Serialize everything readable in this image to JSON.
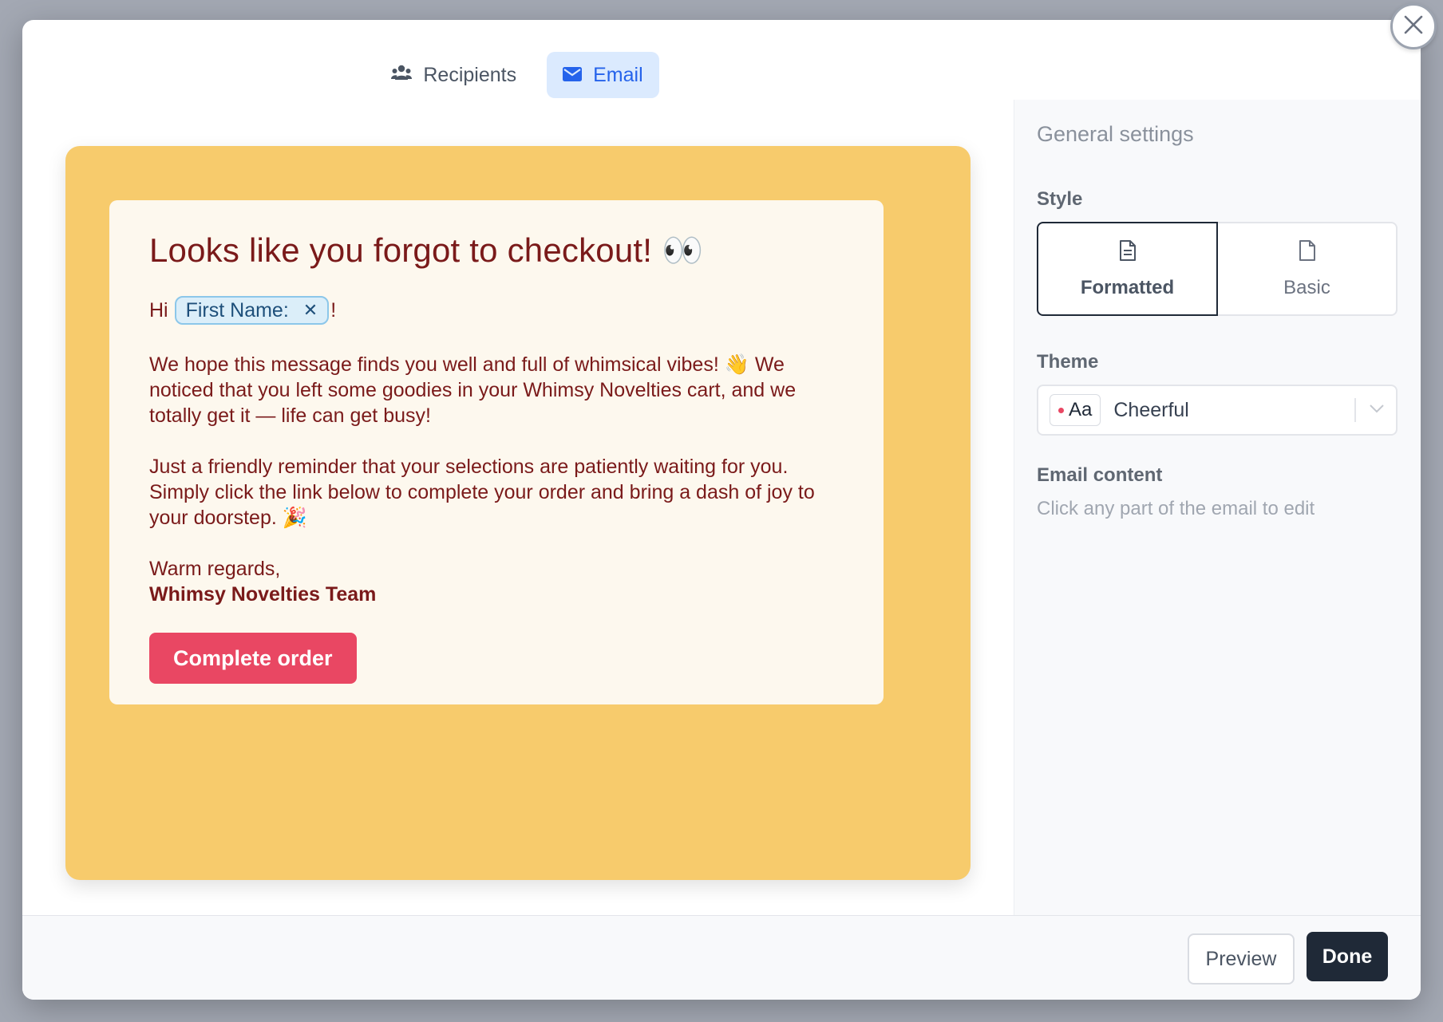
{
  "tabs": [
    {
      "label": "Recipients",
      "icon": "users-icon",
      "active": false
    },
    {
      "label": "Email",
      "icon": "envelope-icon",
      "active": true
    }
  ],
  "email": {
    "title": "Looks like you forgot to checkout!",
    "title_emoji": "👀",
    "greeting_prefix": "Hi",
    "merge_tag": "First Name:",
    "greeting_suffix": "!",
    "paragraph1_a": "We hope this message finds you well and full of whimsical vibes!",
    "paragraph1_emoji": "👋",
    "paragraph1_b": "We noticed that you left some goodies in your Whimsy Novelties cart, and we totally get it — life can get busy!",
    "paragraph2_a": "Just a friendly reminder that your selections are patiently waiting for you. Simply click the link below to complete your order and bring a dash of joy to your doorstep.",
    "paragraph2_emoji": "🎉",
    "signoff": "Warm regards,",
    "team": "Whimsy Novelties Team",
    "cta_label": "Complete order",
    "colors": {
      "background": "#f7cb6c",
      "card": "#fdf8ee",
      "text": "#7a1a1a",
      "button": "#e94763"
    }
  },
  "panel": {
    "title": "General settings",
    "style_label": "Style",
    "style_options": [
      {
        "label": "Formatted",
        "icon": "document-lines-icon",
        "selected": true
      },
      {
        "label": "Basic",
        "icon": "document-blank-icon",
        "selected": false
      }
    ],
    "theme_label": "Theme",
    "theme_badge": "Aa",
    "theme_value": "Cheerful",
    "content_label": "Email content",
    "content_hint": "Click any part of the email to edit"
  },
  "footer": {
    "preview_label": "Preview",
    "done_label": "Done"
  }
}
